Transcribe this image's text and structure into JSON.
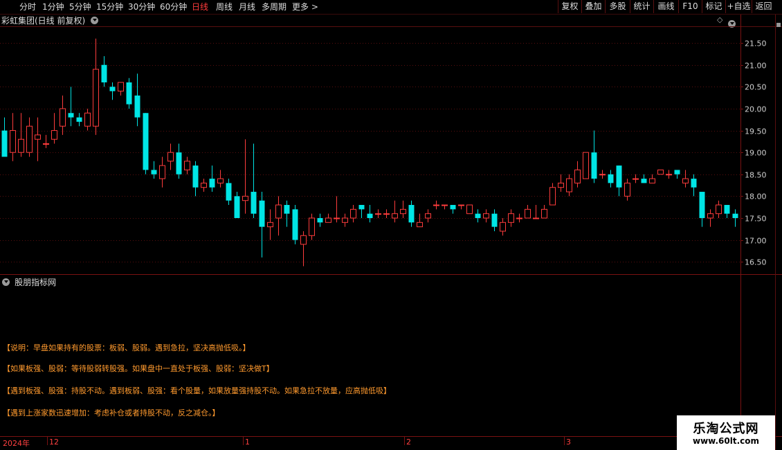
{
  "toolbar": {
    "periods": [
      "分时",
      "1分钟",
      "5分钟",
      "15分钟",
      "30分钟",
      "60分钟",
      "日线",
      "周线",
      "月线",
      "多周期",
      "更多 >"
    ],
    "active_period": "日线",
    "actions": [
      "复权",
      "叠加",
      "多股",
      "统计",
      "画线",
      "F10",
      "标记",
      "+自选",
      "返回"
    ]
  },
  "chart_header": {
    "title": "彩虹集团(日线 前复权)"
  },
  "indicator_header": {
    "title": "股朋指标网"
  },
  "annotations": [
    "【说明：早盘如果持有的股票：板弱、股弱。遇到急拉，坚决高抛低吸。】",
    "【如果板强、股弱：等待股弱转股强。如果盘中一直处于板强、股弱：坚决做T】",
    "【遇到板强、股强：持股不动。遇到板弱、股强：看个股量，如果放量强持股不动。如果急拉不放量，应高抛低吸】",
    "【遇到上涨家数迅速增加：考虑补仓或者持股不动，反之减仓。】"
  ],
  "time_axis": [
    "2024年",
    "12",
    "1",
    "2",
    "3"
  ],
  "watermark": {
    "name": "乐淘公式网",
    "url": "www.60lt.com"
  },
  "colors": {
    "up": "#ff3c3c",
    "down": "#00e5e5",
    "grid": "#5a0f0f",
    "axis_text": "#d0d0d0",
    "annotation": "#ff9a2e"
  },
  "chart_data": {
    "type": "candlestick",
    "ylim": [
      16.25,
      21.85
    ],
    "y_ticks": [
      "21.50",
      "21.00",
      "20.50",
      "20.00",
      "19.50",
      "19.00",
      "18.50",
      "18.00",
      "17.50",
      "17.00",
      "16.50"
    ],
    "candles": [
      [
        19.5,
        18.9,
        19.0,
        19.8
      ],
      [
        19.0,
        19.5,
        18.8,
        19.9
      ],
      [
        19.0,
        19.3,
        18.9,
        19.9
      ],
      [
        19.0,
        19.6,
        18.9,
        19.8
      ],
      [
        19.3,
        19.4,
        18.8,
        19.8
      ],
      [
        19.2,
        19.2,
        19.1,
        19.4
      ],
      [
        19.3,
        19.5,
        19.2,
        19.9
      ],
      [
        19.6,
        20.0,
        19.4,
        20.3
      ],
      [
        19.9,
        19.8,
        19.6,
        20.5
      ],
      [
        19.8,
        19.7,
        19.6,
        19.9
      ],
      [
        19.6,
        19.9,
        19.5,
        20.0
      ],
      [
        19.6,
        20.9,
        19.4,
        21.6
      ],
      [
        21.0,
        20.6,
        20.5,
        21.2
      ],
      [
        20.5,
        20.4,
        20.2,
        20.6
      ],
      [
        20.4,
        20.6,
        20.3,
        20.6
      ],
      [
        20.6,
        20.1,
        20.0,
        20.7
      ],
      [
        20.3,
        19.8,
        19.6,
        20.8
      ],
      [
        19.9,
        18.6,
        18.5,
        19.9
      ],
      [
        18.6,
        18.5,
        18.4,
        18.8
      ],
      [
        18.4,
        18.7,
        18.2,
        18.9
      ],
      [
        18.8,
        19.0,
        18.6,
        19.2
      ],
      [
        19.0,
        18.5,
        18.4,
        19.2
      ],
      [
        18.6,
        18.8,
        18.5,
        18.9
      ],
      [
        18.7,
        18.2,
        18.0,
        18.8
      ],
      [
        18.2,
        18.3,
        18.1,
        18.4
      ],
      [
        18.4,
        18.2,
        18.1,
        18.7
      ],
      [
        18.3,
        18.4,
        18.2,
        18.6
      ],
      [
        18.3,
        17.9,
        17.8,
        18.4
      ],
      [
        18.0,
        17.5,
        17.5,
        18.1
      ],
      [
        17.9,
        18.0,
        17.6,
        19.3
      ],
      [
        18.1,
        17.6,
        17.5,
        19.2
      ],
      [
        17.9,
        17.3,
        16.6,
        18.1
      ],
      [
        17.3,
        17.4,
        17.0,
        17.7
      ],
      [
        17.5,
        17.8,
        17.1,
        18.0
      ],
      [
        17.8,
        17.6,
        17.3,
        17.9
      ],
      [
        17.7,
        17.0,
        16.9,
        17.8
      ],
      [
        16.9,
        17.1,
        16.4,
        17.2
      ],
      [
        17.1,
        17.5,
        17.0,
        17.6
      ],
      [
        17.5,
        17.4,
        17.3,
        17.6
      ],
      [
        17.4,
        17.5,
        17.4,
        17.6
      ],
      [
        17.5,
        17.5,
        17.4,
        18.0
      ],
      [
        17.4,
        17.5,
        17.3,
        17.6
      ],
      [
        17.5,
        17.7,
        17.4,
        17.8
      ],
      [
        17.8,
        17.7,
        17.5,
        17.8
      ],
      [
        17.6,
        17.5,
        17.4,
        17.8
      ],
      [
        17.6,
        17.6,
        17.5,
        17.7
      ],
      [
        17.6,
        17.6,
        17.5,
        17.7
      ],
      [
        17.5,
        17.6,
        17.4,
        17.9
      ],
      [
        17.6,
        17.7,
        17.5,
        17.9
      ],
      [
        17.8,
        17.4,
        17.3,
        17.9
      ],
      [
        17.3,
        17.4,
        17.3,
        17.6
      ],
      [
        17.5,
        17.6,
        17.4,
        17.7
      ],
      [
        17.8,
        17.8,
        17.7,
        17.9
      ],
      [
        17.8,
        17.8,
        17.7,
        17.8
      ],
      [
        17.8,
        17.7,
        17.6,
        17.8
      ],
      [
        17.8,
        17.8,
        17.7,
        17.8
      ],
      [
        17.6,
        17.8,
        17.6,
        17.8
      ],
      [
        17.6,
        17.5,
        17.4,
        17.7
      ],
      [
        17.5,
        17.6,
        17.4,
        17.7
      ],
      [
        17.6,
        17.3,
        17.2,
        17.7
      ],
      [
        17.2,
        17.4,
        17.1,
        17.5
      ],
      [
        17.4,
        17.6,
        17.3,
        17.7
      ],
      [
        17.5,
        17.5,
        17.4,
        17.6
      ],
      [
        17.5,
        17.7,
        17.5,
        17.8
      ],
      [
        17.5,
        17.5,
        17.5,
        17.8
      ],
      [
        17.5,
        17.7,
        17.5,
        17.8
      ],
      [
        17.8,
        18.2,
        17.8,
        18.3
      ],
      [
        18.2,
        18.3,
        18.1,
        18.5
      ],
      [
        18.1,
        18.4,
        18.0,
        18.5
      ],
      [
        18.3,
        18.6,
        18.2,
        18.8
      ],
      [
        18.4,
        19.0,
        18.4,
        19.0
      ],
      [
        19.0,
        18.4,
        18.3,
        19.5
      ],
      [
        18.5,
        18.5,
        18.4,
        18.6
      ],
      [
        18.5,
        18.3,
        18.2,
        18.6
      ],
      [
        18.7,
        18.2,
        18.0,
        18.7
      ],
      [
        18.0,
        18.3,
        17.9,
        18.4
      ],
      [
        18.4,
        18.4,
        18.3,
        18.5
      ],
      [
        18.4,
        18.3,
        18.3,
        18.5
      ],
      [
        18.3,
        18.4,
        18.3,
        18.5
      ],
      [
        18.5,
        18.6,
        18.5,
        18.6
      ],
      [
        18.5,
        18.5,
        18.4,
        18.6
      ],
      [
        18.6,
        18.5,
        18.4,
        18.6
      ],
      [
        18.3,
        18.4,
        18.2,
        18.6
      ],
      [
        18.4,
        18.2,
        18.0,
        18.5
      ],
      [
        18.1,
        17.5,
        17.3,
        18.1
      ],
      [
        17.5,
        17.6,
        17.3,
        17.7
      ],
      [
        17.6,
        17.8,
        17.5,
        17.9
      ],
      [
        17.8,
        17.6,
        17.5,
        17.8
      ],
      [
        17.6,
        17.5,
        17.3,
        17.7
      ]
    ]
  }
}
